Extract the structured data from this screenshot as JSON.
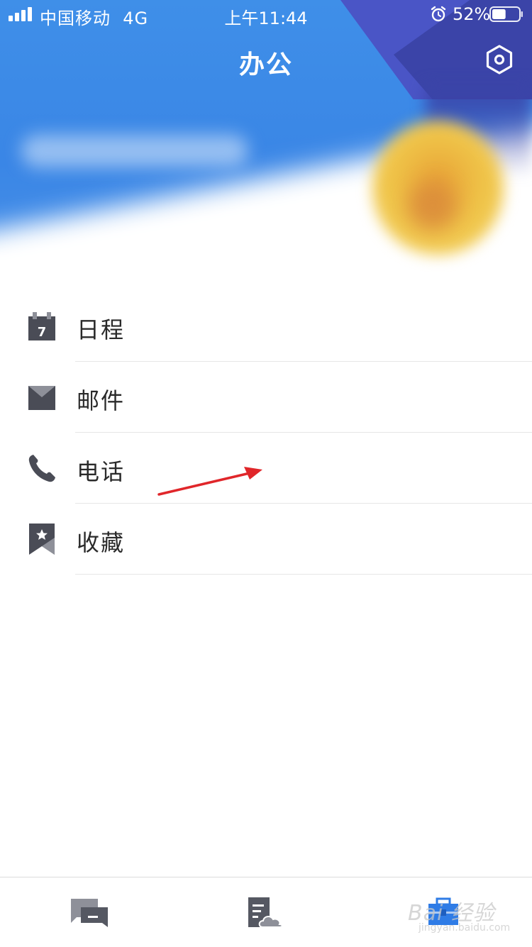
{
  "status_bar": {
    "carrier": "中国移动",
    "network": "4G",
    "time": "上午11:44",
    "battery_percent": "52%",
    "battery_level": 0.52
  },
  "nav": {
    "title": "办公",
    "settings_icon": "settings-hexagon-icon"
  },
  "menu": [
    {
      "label": "日程",
      "icon": "calendar-icon",
      "icon_digit": "7"
    },
    {
      "label": "邮件",
      "icon": "mail-icon"
    },
    {
      "label": "电话",
      "icon": "phone-icon"
    },
    {
      "label": "收藏",
      "icon": "bookmark-star-icon"
    }
  ],
  "tabs": [
    {
      "icon": "chat-icon"
    },
    {
      "icon": "cloud-doc-icon"
    },
    {
      "icon": "briefcase-icon",
      "active": true
    }
  ],
  "watermark": {
    "text": "Bai 经验",
    "sub": "jingyan.baidu.com"
  },
  "colors": {
    "hero_blue": "#3a86e6",
    "hero_indigo": "#3b44a8",
    "icon_gray": "#4a4c56",
    "active_tab_blue": "#2f7ce6",
    "annotation_red": "#e0262a"
  }
}
